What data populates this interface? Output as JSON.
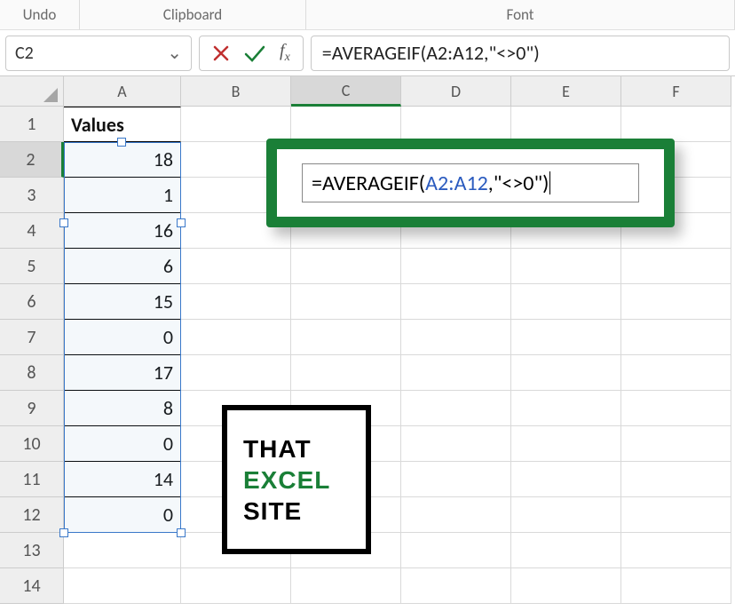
{
  "ribbon": {
    "undo": "Undo",
    "clipboard": "Clipboard",
    "font": "Font"
  },
  "name_box": {
    "value": "C2"
  },
  "formula_bar": {
    "value": "=AVERAGEIF(A2:A12,\"<>0\")"
  },
  "columns": [
    "A",
    "B",
    "C",
    "D",
    "E",
    "F"
  ],
  "active_col": "C",
  "rows": [
    1,
    2,
    3,
    4,
    5,
    6,
    7,
    8,
    9,
    10,
    11,
    12,
    13,
    14
  ],
  "active_row": 2,
  "table": {
    "header": "Values",
    "values": [
      18,
      1,
      16,
      6,
      15,
      0,
      17,
      8,
      0,
      14,
      0
    ]
  },
  "callout": {
    "pre": "=AVERAGEIF(",
    "range": "A2:A12",
    "post": ",\"<>0\")"
  },
  "logo": {
    "l1": "THAT",
    "l2": "EXCEL",
    "l3": "SITE"
  },
  "icons": {
    "chevron": "⌄"
  }
}
